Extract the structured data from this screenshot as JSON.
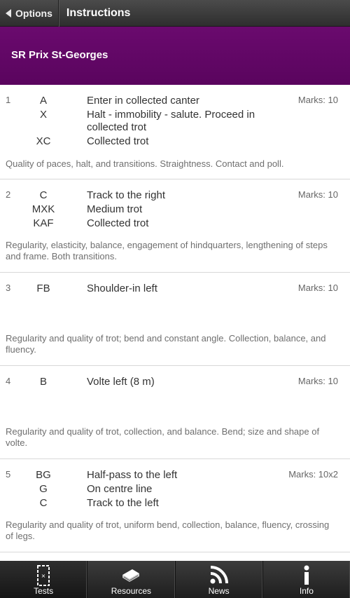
{
  "topbar": {
    "back_label": "Options",
    "title": "Instructions"
  },
  "header": {
    "test_name": "SR Prix St-Georges"
  },
  "movements": [
    {
      "number": "1",
      "marks": "Marks: 10",
      "lines": [
        {
          "letter": "A",
          "text": "Enter in collected canter"
        },
        {
          "letter": "X",
          "text": "Halt - immobility - salute. Proceed in collected trot"
        },
        {
          "letter": "XC",
          "text": "Collected trot"
        }
      ],
      "criteria": "Quality of paces, halt, and transitions. Straightness. Contact and poll."
    },
    {
      "number": "2",
      "marks": "Marks: 10",
      "lines": [
        {
          "letter": "C",
          "text": "Track to the right"
        },
        {
          "letter": "MXK",
          "text": "Medium trot"
        },
        {
          "letter": "KAF",
          "text": "Collected trot"
        }
      ],
      "criteria": "Regularity, elasticity, balance, engagement of hindquarters, lengthening of steps and frame. Both transitions."
    },
    {
      "number": "3",
      "marks": "Marks: 10",
      "lines": [
        {
          "letter": "FB",
          "text": "Shoulder-in left"
        }
      ],
      "criteria": "Regularity and quality of trot; bend and constant angle. Collection, balance, and fluency."
    },
    {
      "number": "4",
      "marks": "Marks: 10",
      "lines": [
        {
          "letter": "B",
          "text": "Volte left (8 m)"
        }
      ],
      "criteria": "Regularity and quality of trot, collection, and balance. Bend; size and shape of volte."
    },
    {
      "number": "5",
      "marks": "Marks: 10x2",
      "lines": [
        {
          "letter": "BG",
          "text": "Half-pass to the left"
        },
        {
          "letter": "G",
          "text": "On centre line"
        },
        {
          "letter": "C",
          "text": "Track to the left"
        }
      ],
      "criteria": "Regularity and quality of trot, uniform bend, collection, balance, fluency, crossing of legs."
    }
  ],
  "tabs": [
    {
      "label": "Tests",
      "icon": "arena-icon",
      "active": true
    },
    {
      "label": "Resources",
      "icon": "book-icon",
      "active": false
    },
    {
      "label": "News",
      "icon": "rss-icon",
      "active": false
    },
    {
      "label": "Info",
      "icon": "info-icon",
      "active": false
    }
  ],
  "colors": {
    "header_purple": "#620866",
    "topbar": "#3a3a3a",
    "tabbar": "#2a2a2a"
  }
}
